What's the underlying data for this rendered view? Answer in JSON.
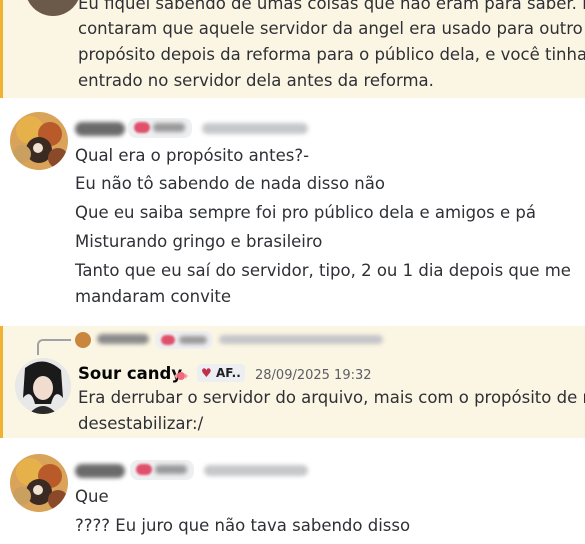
{
  "message_top": {
    "lines": [
      "Eu fiquei sabendo de umas coisas que não eram para saber. Me",
      "contaram que aquele servidor da angel era usado para outro",
      "propósito depois da reforma para o público dela, e você tinha",
      "entrado no servidor dela antes da reforma."
    ]
  },
  "message_2": {
    "lines": [
      "Qual era o propósito antes?-",
      "Eu não tô sabendo de nada disso não",
      "Que eu saiba sempre foi pro público dela e amigos e pá",
      "Misturando gringo e brasileiro",
      "Tanto que eu saí do servidor, tipo, 2 ou 1 dia depois que me",
      "mandaram convite"
    ]
  },
  "message_3": {
    "username": "Sour candy",
    "tag": "AF..",
    "timestamp": "28/09/2025 19:32",
    "lines": [
      "Era derrubar o servidor do arquivo, mais com o propósito de me",
      "desestabilizar:/"
    ]
  },
  "message_4": {
    "lines": [
      "Que",
      "???? Eu juro que não tava sabendo disso"
    ]
  },
  "colors": {
    "highlight_bg": "#fbf5e3",
    "highlight_border": "#f0b232"
  }
}
